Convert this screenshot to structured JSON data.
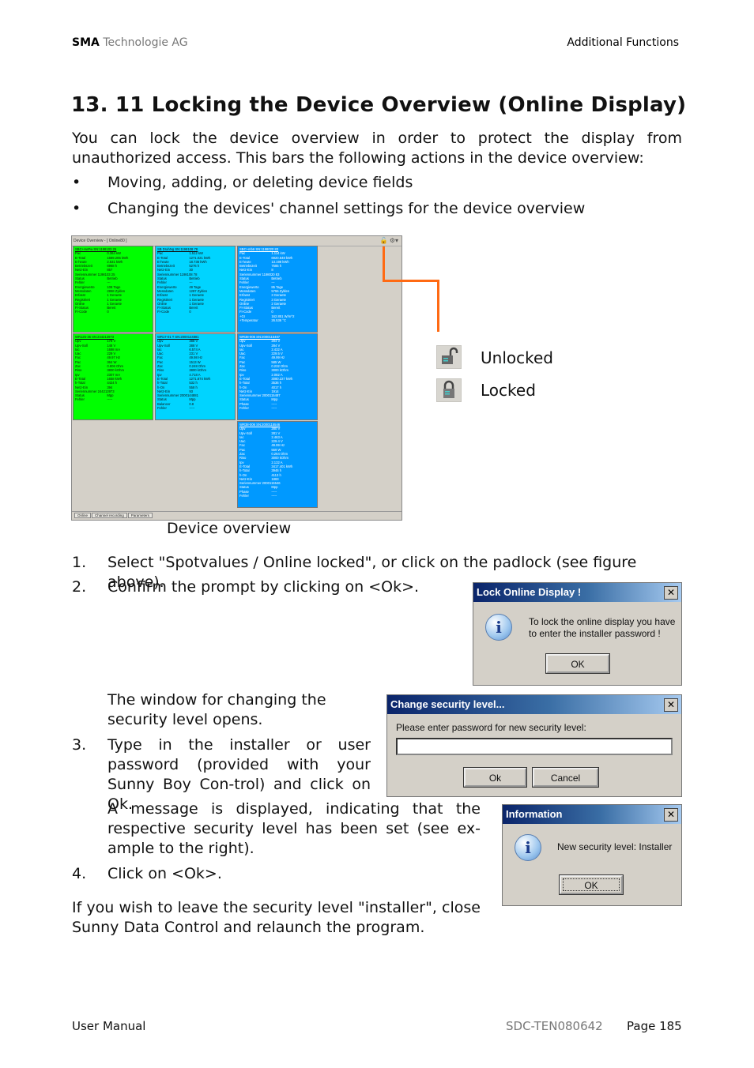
{
  "header": {
    "brand": "SMA",
    "company": "Technologie AG",
    "section": "Additional Functions"
  },
  "title": "13. 11 Locking the Device Overview (Online Display)",
  "intro": "You can lock the device overview in order to protect the display from unauthorized access. This bars the following actions in the device overview:",
  "bullets": [
    "Moving, adding, or deleting device fields",
    "Changing the devices' channel settings for the device overview"
  ],
  "figure": {
    "window_title": "Device Overview - [ Online80 ]",
    "caption": "Device overview",
    "tabs": [
      "Online",
      "Channel recording",
      "Parameters"
    ],
    "legend": [
      {
        "icon": "unlocked-padlock-icon",
        "label": "Unlocked"
      },
      {
        "icon": "locked-padlock-icon",
        "label": "Locked"
      }
    ],
    "accent_color": "#ff6a13",
    "cells": [
      {
        "color": "green",
        "title": "SBC+HePw SN:1198103 25",
        "rows": [
          [
            "Pac",
            "0.364 kW"
          ],
          [
            "E-Total",
            "1689.285 kWh"
          ],
          [
            "E-heute",
            "2.531 kWh"
          ],
          [
            "Betriebszeit",
            "6968 h"
          ],
          [
            "Netz-Ein",
            "857"
          ],
          [
            "Seriennummer 1198103 25",
            ""
          ],
          [
            "Status",
            "Betrieb"
          ],
          [
            "Fehler",
            "---"
          ],
          [
            "Energiewerte",
            "108 Tage"
          ],
          [
            "Messdaten",
            "2858 Zyklen"
          ],
          [
            "Erfasst",
            "1 Geraete"
          ],
          [
            "Registriert",
            "1 Geraete"
          ],
          [
            "Online",
            "1 Geraete"
          ],
          [
            "FI-Status",
            "Bereit"
          ],
          [
            "FI-Code",
            "0"
          ]
        ]
      },
      {
        "color": "cyan",
        "title": "SB DrahNg SN:1198108 78",
        "rows": [
          [
            "Pac",
            "1.512 kW"
          ],
          [
            "E-Total",
            "1271.021 kWh"
          ],
          [
            "E-heute",
            "18.736 kWh"
          ],
          [
            "Betriebszeit",
            "5276 h"
          ],
          [
            "Netz-Ein",
            "30"
          ],
          [
            "Seriennummer 1198108 78",
            ""
          ],
          [
            "Status",
            "Betrieb"
          ],
          [
            "Fehler",
            "---"
          ],
          [
            "Energiewerte",
            "49 Tage"
          ],
          [
            "Messdaten",
            "1287 Zyklen"
          ],
          [
            "Erfasst",
            "1 Geraete"
          ],
          [
            "Registriert",
            "1 Geraete"
          ],
          [
            "Online",
            "1 Geraete"
          ],
          [
            "FI-Status",
            "Bereit"
          ],
          [
            "FI-Code",
            "0"
          ]
        ]
      },
      {
        "color": "blue",
        "title": "SBC+mb6 SN:1198020 83",
        "rows": [
          [
            "Pac",
            "1.114 kW"
          ],
          [
            "E-Total",
            "6920.648 kWh"
          ],
          [
            "E-heute",
            "13.198 kWh"
          ],
          [
            "Betriebszeit",
            "7585 h"
          ],
          [
            "Netz-Ein",
            "8"
          ],
          [
            "Seriennummer 1198020 83",
            ""
          ],
          [
            "Status",
            "Betrieb"
          ],
          [
            "Fehler",
            "---"
          ],
          [
            "Energiewerte",
            "85 Tage"
          ],
          [
            "Messdaten",
            "5755 Zyklen"
          ],
          [
            "Erfasst",
            "3 Geraete"
          ],
          [
            "Registriert",
            "3 Geraete"
          ],
          [
            "Online",
            "2 Geraete"
          ],
          [
            "FI-Status",
            "Bereit"
          ],
          [
            "FI-Code",
            "0"
          ],
          [
            "+GI",
            "162.851 W/m^2"
          ],
          [
            "+Temperatur",
            "26.536 °C"
          ]
        ]
      },
      {
        "color": "green",
        "title": "WR125-36 SN:244213973",
        "rows": [
          [
            "Upv",
            "178 V"
          ],
          [
            "Upv-Soll",
            "148 V"
          ],
          [
            "Iac",
            "1698 mA"
          ],
          [
            "Uac",
            "229 V"
          ],
          [
            "Fac",
            "49.97 Hz"
          ],
          [
            "Pac",
            "364 W"
          ],
          [
            "Zac",
            "0.806 Ohm"
          ],
          [
            "Riso",
            "3800 kOhm"
          ],
          [
            "Ipv",
            "2307 mA"
          ],
          [
            "E-Total",
            "1658 kWh"
          ],
          [
            "h-Total",
            "4424 h"
          ],
          [
            "Netz-Ein",
            "394"
          ],
          [
            "Seriennummer 244213973",
            ""
          ],
          [
            "Status",
            "Mpp"
          ],
          [
            "Fehler",
            "-----"
          ]
        ]
      },
      {
        "color": "cyan",
        "title": "WR17-01 T SN:2000144881",
        "rows": [
          [
            "Upv",
            "388 V"
          ],
          [
            "Upv-Soll",
            "388 V"
          ],
          [
            "Iac",
            "6.574 A"
          ],
          [
            "Uac",
            "231 V"
          ],
          [
            "Fac",
            "49.98 Hz"
          ],
          [
            "Pac",
            "1513 W"
          ],
          [
            "Zac",
            "0.248 Ohm"
          ],
          [
            "Riso",
            "3800 kOhm"
          ],
          [
            "Ipv",
            "4.718 A"
          ],
          [
            "E-Total",
            "1271.874 kWh"
          ],
          [
            "h-Total",
            "532 h"
          ],
          [
            "h-On",
            "558 h"
          ],
          [
            "Netz-Ein",
            "93"
          ],
          [
            "Seriennummer 2000144881",
            ""
          ],
          [
            "Status",
            "Mpp"
          ],
          [
            "Balancer",
            "0.8"
          ],
          [
            "Fehler",
            "-----"
          ]
        ]
      },
      {
        "color": "blue",
        "title": "WR38-005 SN:2000115487",
        "rows": [
          [
            "Upv",
            "284 V"
          ],
          [
            "Upv-Soll",
            "284 V"
          ],
          [
            "Iac",
            "2.432 A"
          ],
          [
            "Uac",
            "229.5 V"
          ],
          [
            "Fac",
            "49.99 Hz"
          ],
          [
            "Pac",
            "585 W"
          ],
          [
            "Zac",
            "0.232 Ohm"
          ],
          [
            "Riso",
            "3000 kOhm"
          ],
          [
            "Ipv",
            "2.082 A"
          ],
          [
            "E-Total",
            "3080.227 kWh"
          ],
          [
            "h-Total",
            "3536 h"
          ],
          [
            "h-On",
            "4017 h"
          ],
          [
            "Netz-Ein",
            "1914"
          ],
          [
            "Seriennummer 2000115487",
            ""
          ],
          [
            "Status",
            "Mpp"
          ],
          [
            "Phase",
            "-----"
          ],
          [
            "Fehler",
            "-----"
          ]
        ]
      },
      {
        "color": "blue",
        "title": "WR38-006 SN:2000115546",
        "rows": [
          [
            "Upv",
            "280 V"
          ],
          [
            "Upv-Soll",
            "281 V"
          ],
          [
            "Iac",
            "2.463 A"
          ],
          [
            "Uac",
            "229.4 V"
          ],
          [
            "Fac",
            "49.99 Hz"
          ],
          [
            "Pac",
            "559 W"
          ],
          [
            "Zac",
            "0.264 Ohm"
          ],
          [
            "Riso",
            "3000 kOhm"
          ],
          [
            "Ipv",
            "2.132 A"
          ],
          [
            "E-Total",
            "3417.401 kWh"
          ],
          [
            "h-Total",
            "3946 h"
          ],
          [
            "h-On",
            "4113 h"
          ],
          [
            "Netz-Ein",
            "1883"
          ],
          [
            "Seriennummer 2000115546",
            ""
          ],
          [
            "Status",
            "Mpp"
          ],
          [
            "Phase",
            "-----"
          ],
          [
            "Fehler",
            "-----"
          ]
        ]
      }
    ]
  },
  "steps": {
    "s1_num": "1.",
    "s1": "Select \"Spotvalues / Online locked\", or click on the padlock (see figure above).",
    "s2_num": "2.",
    "s2": "Confirm the prompt by clicking on <Ok>.",
    "window_opens": "The window for changing the security level opens.",
    "s3_num": "3.",
    "s3": "Type in the installer or user password (provided with your Sunny Boy Con-trol) and click on Ok.",
    "message": "A message is displayed, indicating that the respective security level has been set (see ex-ample to the right).",
    "s4_num": "4.",
    "s4": "Click on <Ok>."
  },
  "closing": "If you wish to leave the security level \"installer\", close Sunny Data Control and relaunch the program.",
  "dialog_lock": {
    "title": "Lock Online Display !",
    "message_1": "To lock the online display you have",
    "message_2": "to enter the installer password !",
    "ok": "OK"
  },
  "dialog_security": {
    "title": "Change security level...",
    "prompt": "Please enter password for new security level:",
    "input_value": "",
    "ok": "Ok",
    "cancel": "Cancel"
  },
  "dialog_info": {
    "title": "Information",
    "message": "New security level: Installer",
    "ok": "OK"
  },
  "footer": {
    "left": "User Manual",
    "doc_id": "SDC-TEN080642",
    "page": "Page 185"
  }
}
